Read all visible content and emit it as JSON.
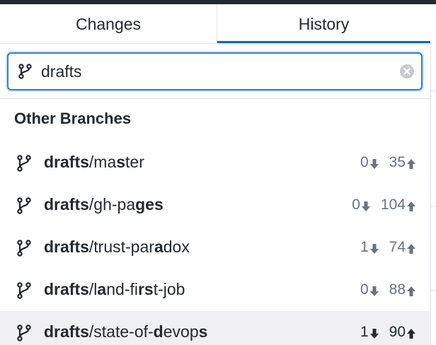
{
  "tabs": [
    {
      "label": "Changes",
      "selected": false
    },
    {
      "label": "History",
      "selected": true
    }
  ],
  "colors": {
    "accent": "#0366d6",
    "text": "#24292e",
    "muted": "#6a737d",
    "selected_row": "#f0f0f2"
  },
  "search": {
    "value": "drafts",
    "placeholder": "",
    "icon": "branch-icon",
    "clear_icon": "clear-icon"
  },
  "section_header": "Other Branches",
  "branches": [
    {
      "prefix": "drafts",
      "segments": [
        {
          "t": "/",
          "b": false
        },
        {
          "t": "ma",
          "b": false
        },
        {
          "t": "s",
          "b": true
        },
        {
          "t": "ter",
          "b": false
        }
      ],
      "behind": "0",
      "ahead": "35",
      "selected": false
    },
    {
      "prefix": "drafts",
      "segments": [
        {
          "t": "/gh-pa",
          "b": false
        },
        {
          "t": "ges",
          "b": true
        }
      ],
      "behind": "0",
      "ahead": "104",
      "selected": false
    },
    {
      "prefix": "drafts",
      "segments": [
        {
          "t": "/trust-par",
          "b": false
        },
        {
          "t": "a",
          "b": true
        },
        {
          "t": "dox",
          "b": false
        }
      ],
      "behind": "1",
      "ahead": "74",
      "selected": false
    },
    {
      "prefix": "drafts",
      "segments": [
        {
          "t": "/l",
          "b": false
        },
        {
          "t": "a",
          "b": true
        },
        {
          "t": "nd-fi",
          "b": false
        },
        {
          "t": "rs",
          "b": true
        },
        {
          "t": "t-job",
          "b": false
        }
      ],
      "behind": "0",
      "ahead": "88",
      "selected": false
    },
    {
      "prefix": "drafts",
      "segments": [
        {
          "t": "/state-of-",
          "b": false
        },
        {
          "t": "d",
          "b": true
        },
        {
          "t": "evop",
          "b": false
        },
        {
          "t": "s",
          "b": true
        }
      ],
      "behind": "1",
      "ahead": "90",
      "selected": true
    }
  ]
}
